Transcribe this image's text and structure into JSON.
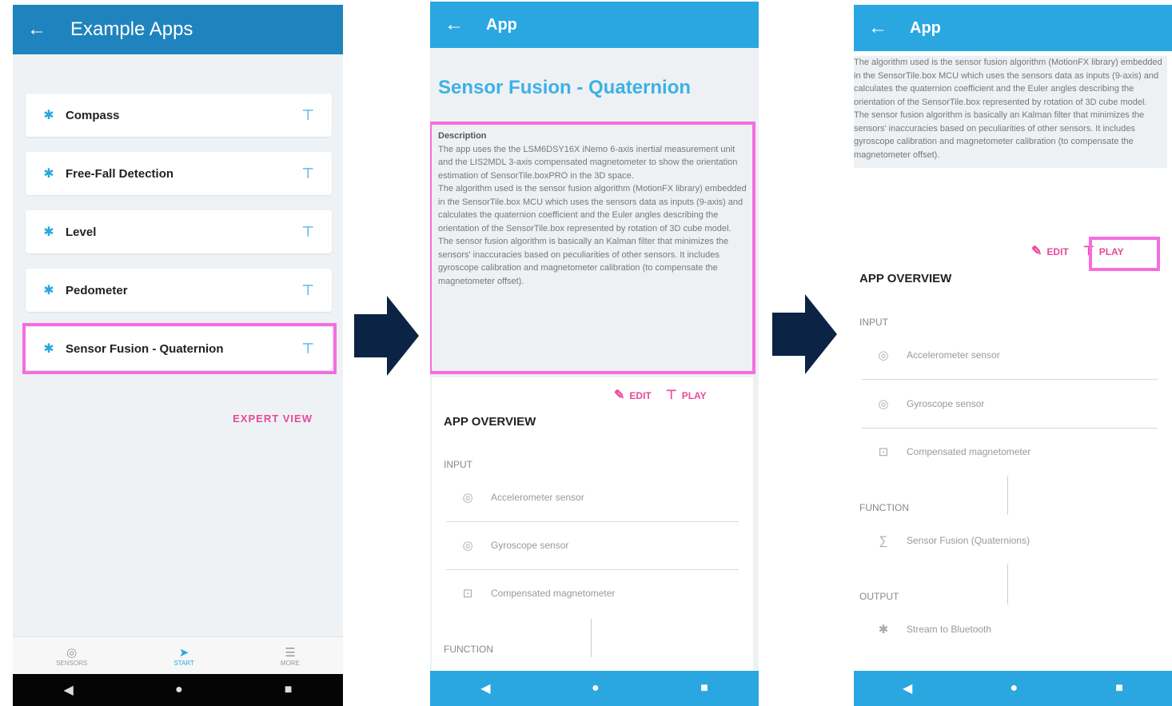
{
  "screen1": {
    "title": "Example Apps",
    "apps": [
      {
        "label": "Compass"
      },
      {
        "label": "Free-Fall Detection"
      },
      {
        "label": "Level"
      },
      {
        "label": "Pedometer"
      },
      {
        "label": "Sensor Fusion - Quaternion"
      }
    ],
    "expert_view": "EXPERT VIEW",
    "tabs": [
      {
        "label": "SENSORS"
      },
      {
        "label": "START"
      },
      {
        "label": "MORE"
      }
    ]
  },
  "screen2": {
    "title": "App",
    "app_title": "Sensor Fusion - Quaternion",
    "description_heading": "Description",
    "description_paragraphs": [
      "The app uses the the LSM6DSY16X iNemo 6-axis inertial measurement unit and the LIS2MDL 3-axis compensated magnetometer to show the orientation estimation of SensorTile.boxPRO in the 3D space.",
      "The algorithm used is the sensor fusion algorithm (MotionFX library) embedded in the SensorTile.box MCU which uses the sensors data as inputs (9-axis) and calculates the quaternion coefficient and the Euler angles describing the orientation of the SensorTile.box represented by rotation of 3D cube model.",
      "The sensor fusion algorithm is basically an Kalman filter that minimizes the sensors' inaccuracies based on peculiarities of other sensors. It includes gyroscope calibration and magnetometer calibration (to compensate the magnetometer offset)."
    ],
    "edit": "EDIT",
    "play": "PLAY",
    "overview": "APP OVERVIEW",
    "input_label": "INPUT",
    "inputs": [
      "Accelerometer sensor",
      "Gyroscope sensor",
      "Compensated magnetometer"
    ],
    "function_label": "FUNCTION"
  },
  "screen3": {
    "title": "App",
    "description_paragraphs": [
      "The algorithm used is the sensor fusion algorithm (MotionFX library) embedded in the SensorTile.box MCU which uses the sensors data as inputs (9-axis) and calculates the quaternion coefficient and the Euler angles describing the orientation of the SensorTile.box represented by rotation of 3D cube model.",
      "The sensor fusion algorithm is basically an Kalman filter that minimizes the sensors' inaccuracies based on peculiarities of other sensors. It includes gyroscope calibration and magnetometer calibration (to compensate the magnetometer offset)."
    ],
    "edit": "EDIT",
    "play": "PLAY",
    "overview": "APP OVERVIEW",
    "input_label": "INPUT",
    "inputs": [
      "Accelerometer sensor",
      "Gyroscope sensor",
      "Compensated magnetometer"
    ],
    "function_label": "FUNCTION",
    "function_item": "Sensor Fusion (Quaternions)",
    "output_label": "OUTPUT",
    "output_item": "Stream to Bluetooth"
  },
  "colors": {
    "header_dark": "#1f83be",
    "header_light": "#2aa7e0",
    "highlight": "#f46ee0",
    "accent_pink": "#e8489c",
    "arrow": "#0b2344"
  }
}
